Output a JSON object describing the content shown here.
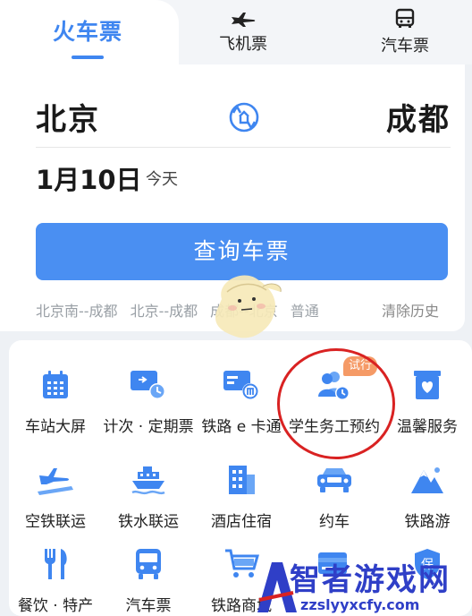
{
  "tabs": {
    "train": "火车票",
    "plane": "飞机票",
    "bus": "汽车票"
  },
  "search": {
    "from": "北京",
    "to": "成都",
    "date": "1月10日",
    "date_hint": "今天",
    "query_button": "查询车票"
  },
  "history": {
    "items": [
      "北京南--成都",
      "北京--成都",
      "成都--北京",
      "普通"
    ],
    "clear": "清除历史"
  },
  "services": [
    {
      "label": "车站大屏",
      "icon": "calendar-icon"
    },
    {
      "label": "计次 · 定期票",
      "icon": "ticket-clock-icon"
    },
    {
      "label": "铁路 e 卡通",
      "icon": "railcard-icon"
    },
    {
      "label": "学生务工预约",
      "icon": "people-clock-icon"
    },
    {
      "label": "温馨服务",
      "icon": "heart-box-icon"
    },
    {
      "label": "空铁联运",
      "icon": "plane-train-icon"
    },
    {
      "label": "铁水联运",
      "icon": "ship-icon"
    },
    {
      "label": "酒店住宿",
      "icon": "hotel-icon"
    },
    {
      "label": "约车",
      "icon": "car-icon"
    },
    {
      "label": "铁路游",
      "icon": "mountain-icon"
    },
    {
      "label": "餐饮 · 特产",
      "icon": "fork-knife-icon"
    },
    {
      "label": "汽车票",
      "icon": "bus-icon"
    },
    {
      "label": "铁路商城",
      "icon": "cart-icon"
    },
    {
      "label": "",
      "icon": "card-icon"
    },
    {
      "label": "",
      "icon": "insurance-icon"
    }
  ],
  "badge": "试行",
  "watermark": {
    "title": "智者游戏网",
    "url": "zzslyyxcfy.com"
  },
  "colors": {
    "accent": "#3f86f0",
    "button": "#4a8ff2",
    "badge": "#f59a66",
    "annotation": "#d92222"
  }
}
